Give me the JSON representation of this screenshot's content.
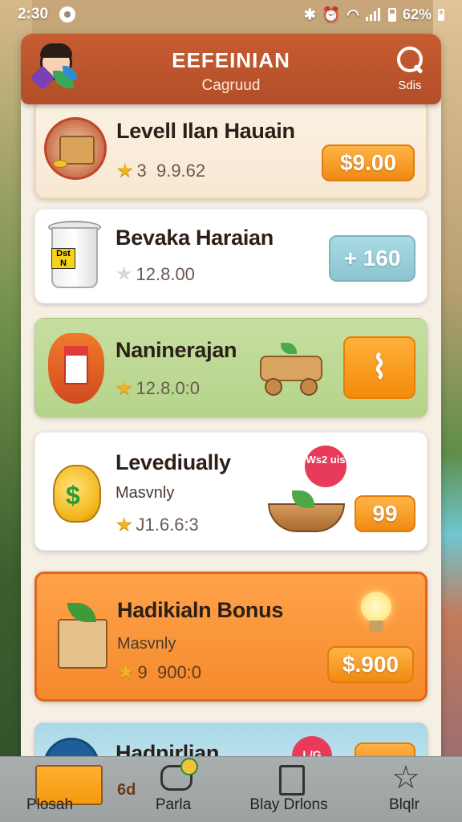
{
  "status_bar": {
    "time": "2:30",
    "battery": "62%"
  },
  "header": {
    "title": "EEFEINIAN",
    "subtitle": "Cagruud",
    "search_label": "Sdis"
  },
  "cards": [
    {
      "title": "Levell Ilan Hauain",
      "sub": "",
      "meta": "3  9.9.62",
      "price": "$9.00",
      "style": "highlight-cream"
    },
    {
      "title": "Bevaka Haraian",
      "sub": "",
      "meta": "12.8.00",
      "price": "+ 160",
      "style": "white"
    },
    {
      "title": "Naninerajan",
      "sub": "",
      "meta": "12.8.0:0",
      "price": "",
      "style": "green"
    },
    {
      "title": "Levediually",
      "sub": "Masvnly",
      "meta": "J1.6.6:3",
      "price": "99",
      "badge": "Ws2 uis",
      "style": "white"
    },
    {
      "title": "Hadikialn Bonus",
      "sub": "Masvnly",
      "meta": "9  900:0",
      "price": "$.900",
      "style": "orange"
    },
    {
      "title": "Hadnirlian",
      "sub": "",
      "meta": "",
      "price": "",
      "badge": "L/G",
      "style": "blue"
    }
  ],
  "nav": [
    {
      "label": "Plosah",
      "extra": "6d"
    },
    {
      "label": "Parla"
    },
    {
      "label": "Blay Drlons"
    },
    {
      "label": "Blqlr"
    }
  ]
}
